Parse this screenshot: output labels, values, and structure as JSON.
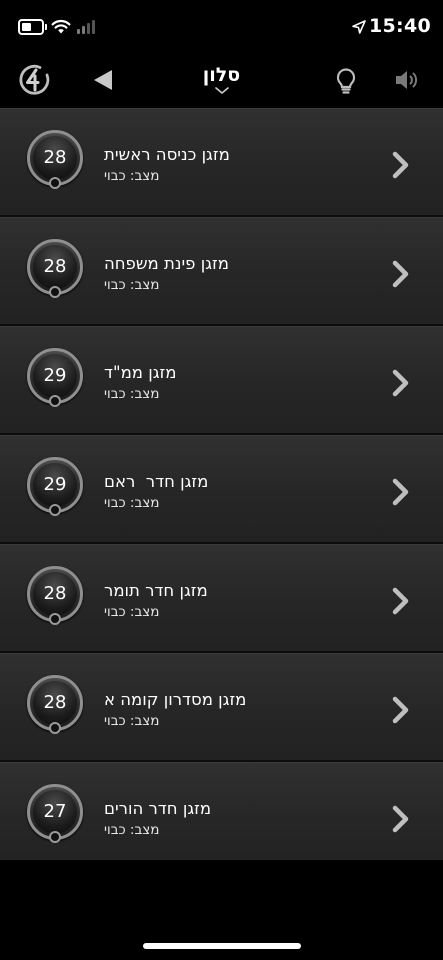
{
  "status_bar": {
    "time": "15:40",
    "battery_icon": "battery-icon",
    "wifi_icon": "wifi-icon",
    "signal_icon": "cellular-signal-icon",
    "location_icon": "location-arrow-icon"
  },
  "nav": {
    "title": "סלון",
    "logo_icon": "power-logo-icon",
    "back_icon": "back-triangle-icon",
    "bulb_icon": "lightbulb-icon",
    "speaker_icon": "speaker-icon",
    "caret_icon": "chevron-down-icon"
  },
  "devices": [
    {
      "name": "מזגן כניסה ראשית",
      "status": "מצב: כבוי",
      "temperature": "28"
    },
    {
      "name": "מזגן פינת משפחה",
      "status": "מצב: כבוי",
      "temperature": "28"
    },
    {
      "name": "מזגן ממ\"ד",
      "status": "מצב: כבוי",
      "temperature": "29"
    },
    {
      "name": "מזגן חדר  ראם",
      "status": "מצב: כבוי",
      "temperature": "29"
    },
    {
      "name": "מזגן חדר תומר",
      "status": "מצב: כבוי",
      "temperature": "28"
    },
    {
      "name": "מזגן מסדרון קומה א",
      "status": "מצב: כבוי",
      "temperature": "28"
    },
    {
      "name": "מזגן חדר הורים",
      "status": "מצב: כבוי",
      "temperature": "27"
    }
  ],
  "colors": {
    "background": "#000000",
    "row": "#2a2a2a",
    "text": "#ffffff",
    "icon_gray": "#8a8a8a"
  }
}
